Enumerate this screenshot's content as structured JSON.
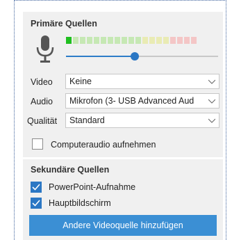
{
  "primary": {
    "title": "Primäre Quellen",
    "icon": "microphone-icon",
    "meter": {
      "colors": [
        "#1fbf1f",
        "#c6e8b4",
        "#c6e8b4",
        "#c6e8b4",
        "#c6e8b4",
        "#c6e8b4",
        "#c6e8b4",
        "#c6e8b4",
        "#c6e8b4",
        "#c6e8b4",
        "#c6e8b4",
        "#e9ebb4",
        "#e9ebb4",
        "#e9ebb4",
        "#e9ebb4",
        "#f4c6c6",
        "#f4c6c6",
        "#f4c6c6",
        "#f4c6c6"
      ],
      "level": 1
    },
    "volume": 0.45,
    "video": {
      "label": "Video",
      "value": "Keine"
    },
    "audio": {
      "label": "Audio",
      "value": "Mikrofon (3- USB Advanced Aud"
    },
    "quality": {
      "label": "Qualität",
      "value": "Standard"
    },
    "computer_audio": {
      "label": "Computeraudio aufnehmen",
      "checked": false
    }
  },
  "secondary": {
    "title": "Sekundäre Quellen",
    "items": [
      {
        "label": "PowerPoint-Aufnahme",
        "checked": true
      },
      {
        "label": "Hauptbildschirm",
        "checked": true
      }
    ],
    "add_button": "Andere Videoquelle hinzufügen"
  },
  "colors": {
    "accent": "#2b77c4",
    "button": "#3b8fd4",
    "panel": "#f0f0f0"
  }
}
